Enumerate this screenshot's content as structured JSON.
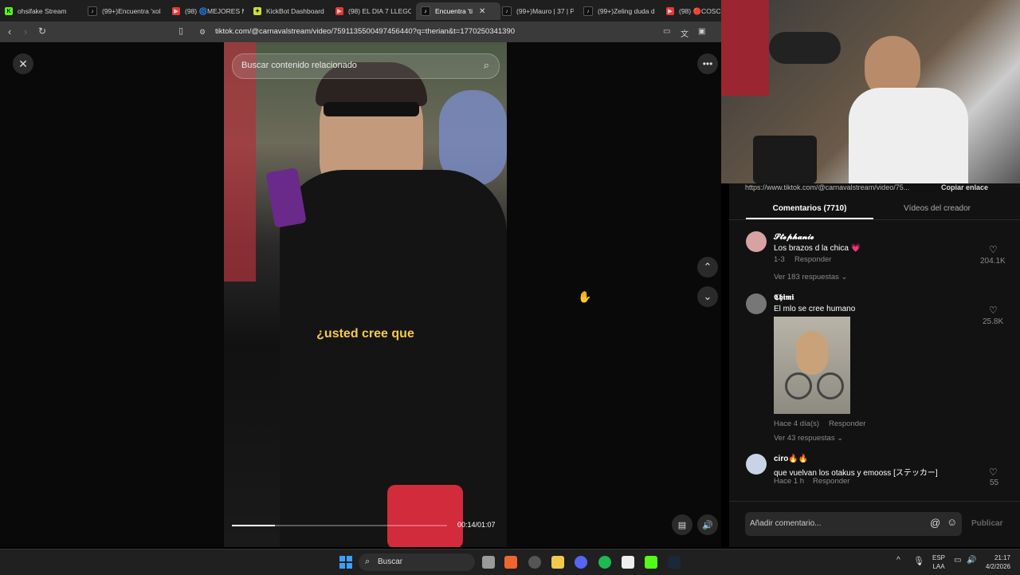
{
  "tabs": [
    {
      "label": "ohsifake Stream",
      "color": "#53fc18"
    },
    {
      "label": "(99+)Encuentra 'xol",
      "color": "#111"
    },
    {
      "label": "(98) 🌀MEJORES M",
      "color": "#e53935"
    },
    {
      "label": "KickBot Dashboard",
      "color": "#cddc39"
    },
    {
      "label": "(98) EL DIA 7 LLEGO",
      "color": "#e53935"
    },
    {
      "label": "Encuentra 'ti",
      "color": "#111",
      "active": true
    },
    {
      "label": "(99+)Mauro | 37 | P",
      "color": "#111"
    },
    {
      "label": "(99+)Zeling duda d",
      "color": "#111"
    },
    {
      "label": "(98) 🔴COSCU",
      "color": "#e53935"
    }
  ],
  "address": {
    "url": "tiktok.com/@carnavalstream/video/7591135500497456440?q=therian&t=1770250341390"
  },
  "video": {
    "search_placeholder": "Buscar contenido relacionado",
    "caption": "¿usted cree que",
    "time": "00:14/01:07",
    "progress": 0.2
  },
  "panel": {
    "link_text": "https://www.tiktok.com/@carnavalstream/video/75...",
    "copy_link": "Copiar enlace",
    "tab_comments": "Comentarios (7710)",
    "tab_creator": "Vídeos del creador",
    "comments": [
      {
        "user": "𝓢𝓽𝓮𝓹𝓱𝓪𝓷𝓲𝓮",
        "text": "Los brazos d la chica 💗",
        "meta": "1-3",
        "reply": "Responder",
        "likes": "204.1K",
        "more": "Ver 183 respuestas"
      },
      {
        "user": "𝕮𝖍𝖎𝖒𝖎",
        "text": "El mlo se cree humano",
        "meta": "Hace 4 día(s)",
        "reply": "Responder",
        "likes": "25.8K",
        "more": "Ver 43 respuestas"
      },
      {
        "user": "ciro🔥🔥",
        "text": "que vuelvan los otakus y emooss [ステッカー]",
        "meta": "Hace 1 h",
        "reply": "Responder",
        "likes": "55"
      }
    ],
    "comment_placeholder": "Añadir comentario...",
    "publish": "Publicar"
  },
  "taskbar": {
    "search": "Buscar",
    "lang1": "ESP",
    "lang2": "LAA",
    "time": "21:17",
    "date": "4/2/2026"
  }
}
